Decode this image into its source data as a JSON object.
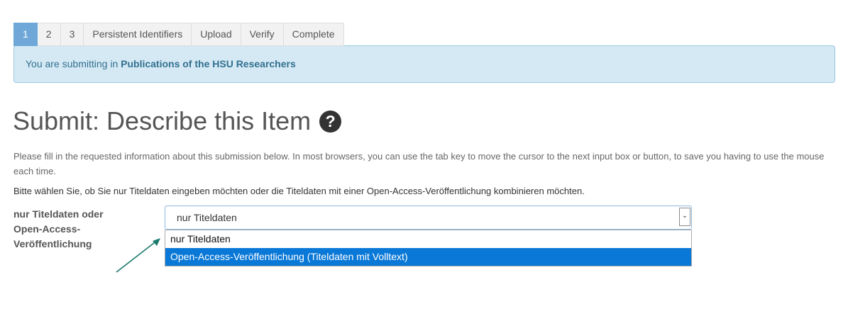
{
  "steps": [
    {
      "label": "1",
      "active": true
    },
    {
      "label": "2",
      "active": false
    },
    {
      "label": "3",
      "active": false
    },
    {
      "label": "Persistent Identifiers",
      "active": false
    },
    {
      "label": "Upload",
      "active": false
    },
    {
      "label": "Verify",
      "active": false
    },
    {
      "label": "Complete",
      "active": false
    }
  ],
  "alert": {
    "prefix": "You are submitting in ",
    "collection": "Publications of the HSU Researchers"
  },
  "page": {
    "title": "Submit: Describe this Item",
    "help_icon": "question-circle-icon",
    "description": "Please fill in the requested information about this submission below. In most browsers, you can use the tab key to move the cursor to the next input box or button, to save you having to use the mouse each time.",
    "instruction": "Bitte wählen Sie, ob Sie nur Titeldaten eingeben möchten oder die Titeldaten mit einer Open-Access-Veröffentlichung kombinieren möchten."
  },
  "field": {
    "label": "nur Titeldaten oder Open-Access-Veröffentlichung",
    "selected_value": "nur Titeldaten",
    "options": [
      {
        "label": "nur Titeldaten",
        "highlighted": false
      },
      {
        "label": "Open-Access-Veröffentlichung (Titeldaten mit Volltext)",
        "highlighted": true
      }
    ]
  },
  "colors": {
    "active_step": "#6fa8d8",
    "alert_bg": "#d5e9f4",
    "alert_text": "#31708f",
    "highlight": "#0a78d7",
    "annotation_arrow": "#1a7a6e"
  }
}
